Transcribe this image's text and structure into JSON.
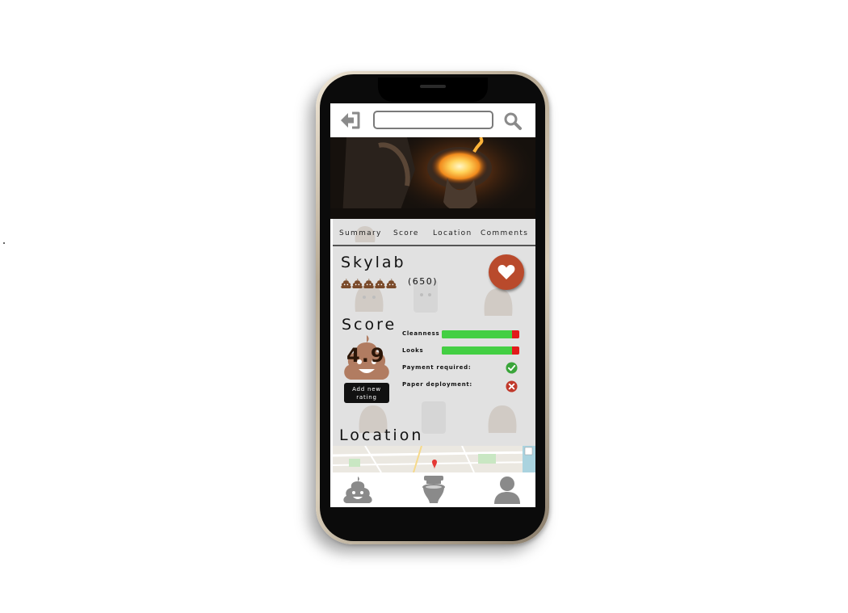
{
  "search": {
    "placeholder": "",
    "value": ""
  },
  "tabs": [
    {
      "label": "Summary"
    },
    {
      "label": "Score"
    },
    {
      "label": "Location"
    },
    {
      "label": "Comments"
    }
  ],
  "place": {
    "name": "Skylab",
    "rating_icons": 5,
    "review_count": "(650)"
  },
  "score": {
    "heading": "Score",
    "value": "4.9",
    "add_rating_label_line1": "Add new",
    "add_rating_label_line2": "rating",
    "metrics": [
      {
        "label": "Cleanness",
        "fraction": 0.91
      },
      {
        "label": "Looks",
        "fraction": 0.91
      }
    ],
    "flags": [
      {
        "label": "Payment required:",
        "status": "check-icon"
      },
      {
        "label": "Paper deployment:",
        "status": "cross-icon"
      }
    ]
  },
  "location": {
    "heading": "Location"
  },
  "colors": {
    "accent": "#b94a2c",
    "bar_good": "#43cf43",
    "bar_bad": "#e21b1b",
    "check": "#3aa53a",
    "cross": "#c0392b",
    "icon_gray": "#8a8a8a"
  },
  "nav": [
    {
      "icon": "poop-icon"
    },
    {
      "icon": "toilet-icon"
    },
    {
      "icon": "user-icon"
    }
  ]
}
